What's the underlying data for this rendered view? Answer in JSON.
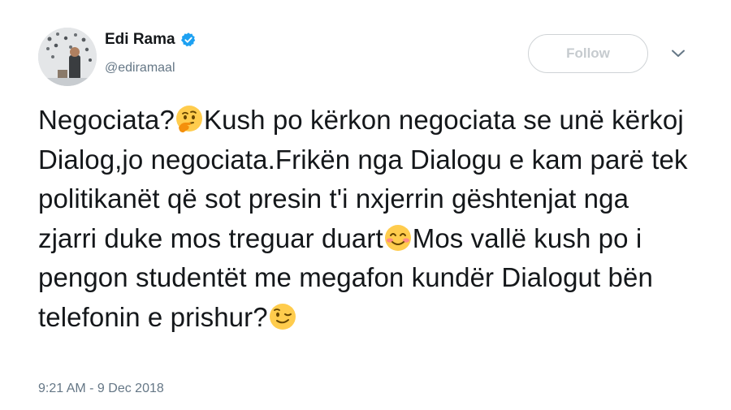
{
  "author": {
    "display_name": "Edi Rama",
    "handle": "@ediramaal",
    "verified": true,
    "avatar": "avatar-photo"
  },
  "header": {
    "follow_label": "Follow",
    "menu_icon": "chevron-down-icon",
    "verified_icon": "verified-badge-icon"
  },
  "tweet": {
    "segments": [
      "Negociata?",
      "Kush po kërkon negociata se unë kërkoj Dialog,jo negociata.Frikën nga Dialogu e kam parë tek politikanët që sot presin t'i nxjerrin gështenjat nga zjarri duke mos treguar duart",
      "Mos vallë kush po i pengon studentët me megafon kundër Dialogut bën telefonin e prishur?"
    ],
    "emojis": [
      "thinking-face-icon",
      "smiling-face-with-smiling-eyes-icon",
      "winking-face-icon"
    ]
  },
  "timestamp": "9:21 AM - 9 Dec 2018",
  "colors": {
    "text": "#14171a",
    "secondary": "#657786",
    "verified": "#1da1f2",
    "emoji": "#ffcc4d",
    "follow_border": "#cfd3d6"
  }
}
